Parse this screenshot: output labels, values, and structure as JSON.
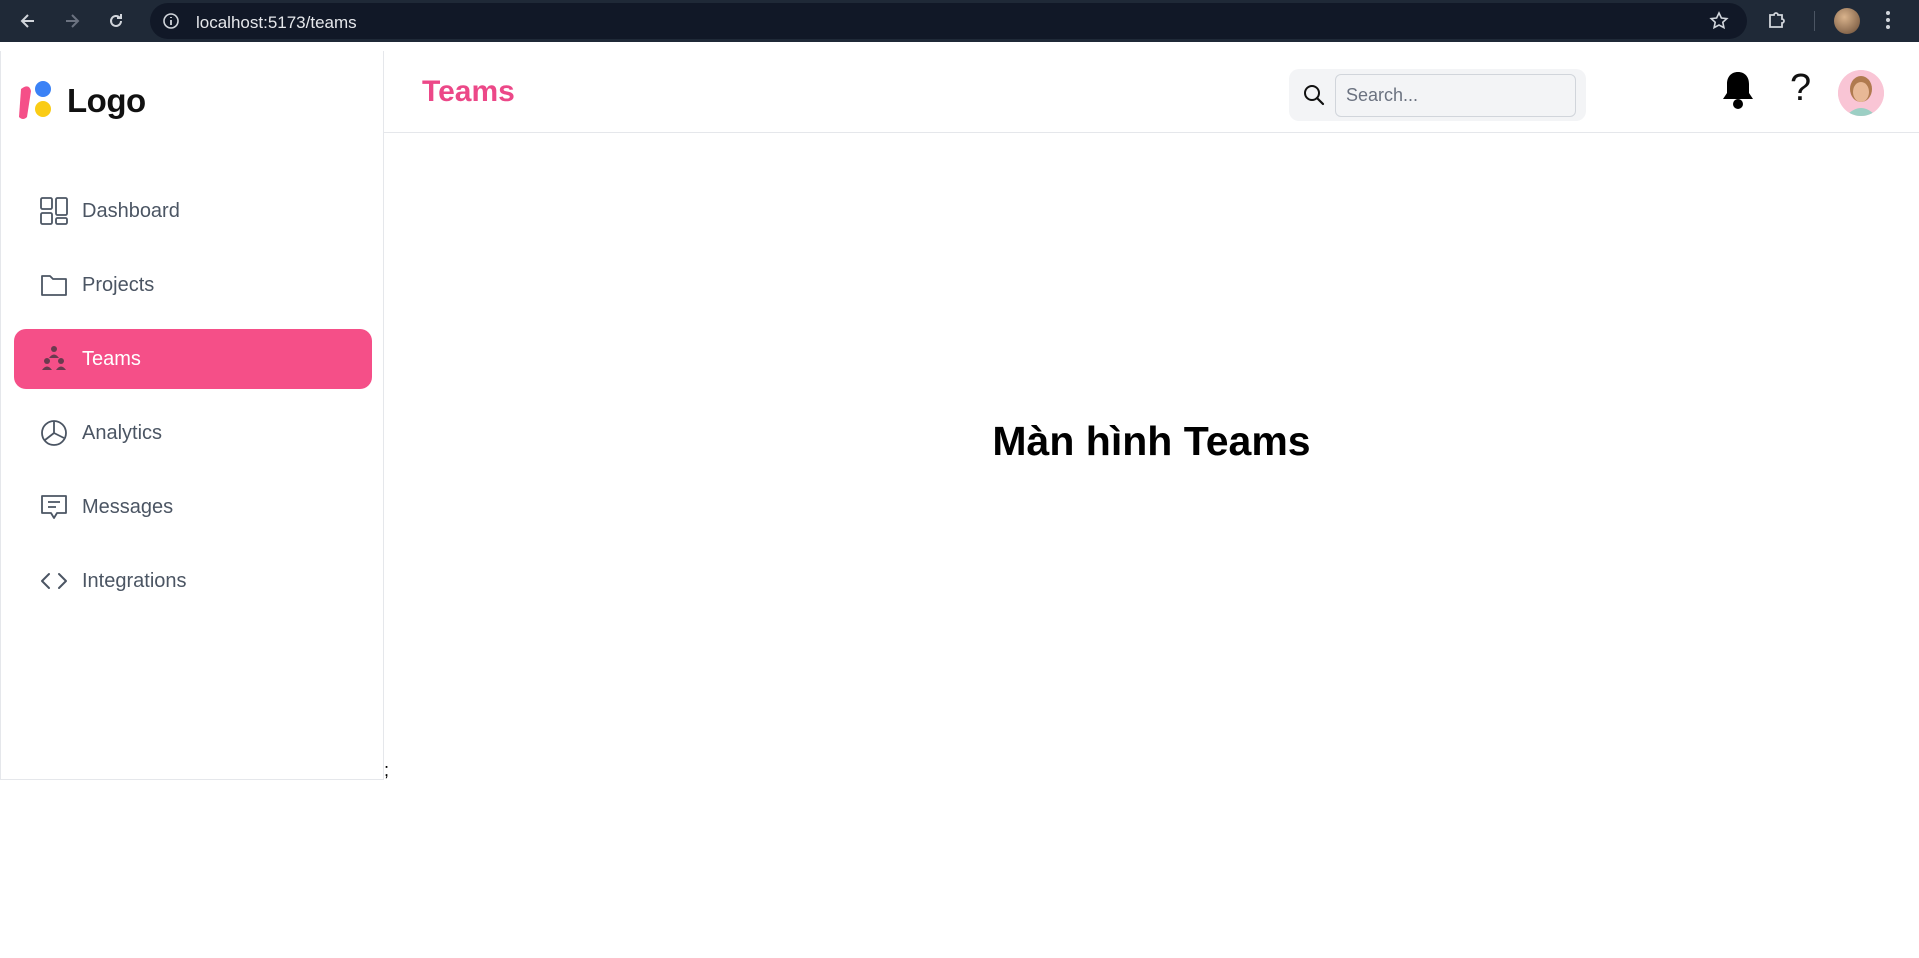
{
  "browser": {
    "url": "localhost:5173/teams",
    "icons": {
      "back": "arrow-left-icon",
      "forward": "arrow-right-icon",
      "reload": "reload-icon",
      "site_info": "info-icon",
      "bookmark": "star-icon",
      "extensions": "puzzle-icon",
      "menu": "kebab-menu-icon"
    }
  },
  "sidebar": {
    "logo_text": "Logo",
    "items": [
      {
        "label": "Dashboard",
        "icon": "dashboard-grid-icon",
        "active": false
      },
      {
        "label": "Projects",
        "icon": "folder-icon",
        "active": false
      },
      {
        "label": "Teams",
        "icon": "team-icon",
        "active": true
      },
      {
        "label": "Analytics",
        "icon": "pie-chart-icon",
        "active": false
      },
      {
        "label": "Messages",
        "icon": "message-icon",
        "active": false
      },
      {
        "label": "Integrations",
        "icon": "code-icon",
        "active": false
      }
    ]
  },
  "header": {
    "title": "Teams",
    "search_placeholder": "Search...",
    "help_glyph": "?"
  },
  "main": {
    "heading": "Màn hình Teams",
    "stray_text": ";"
  },
  "colors": {
    "accent": "#f54f88",
    "title": "#ec4888",
    "chrome": "#1f2937"
  }
}
